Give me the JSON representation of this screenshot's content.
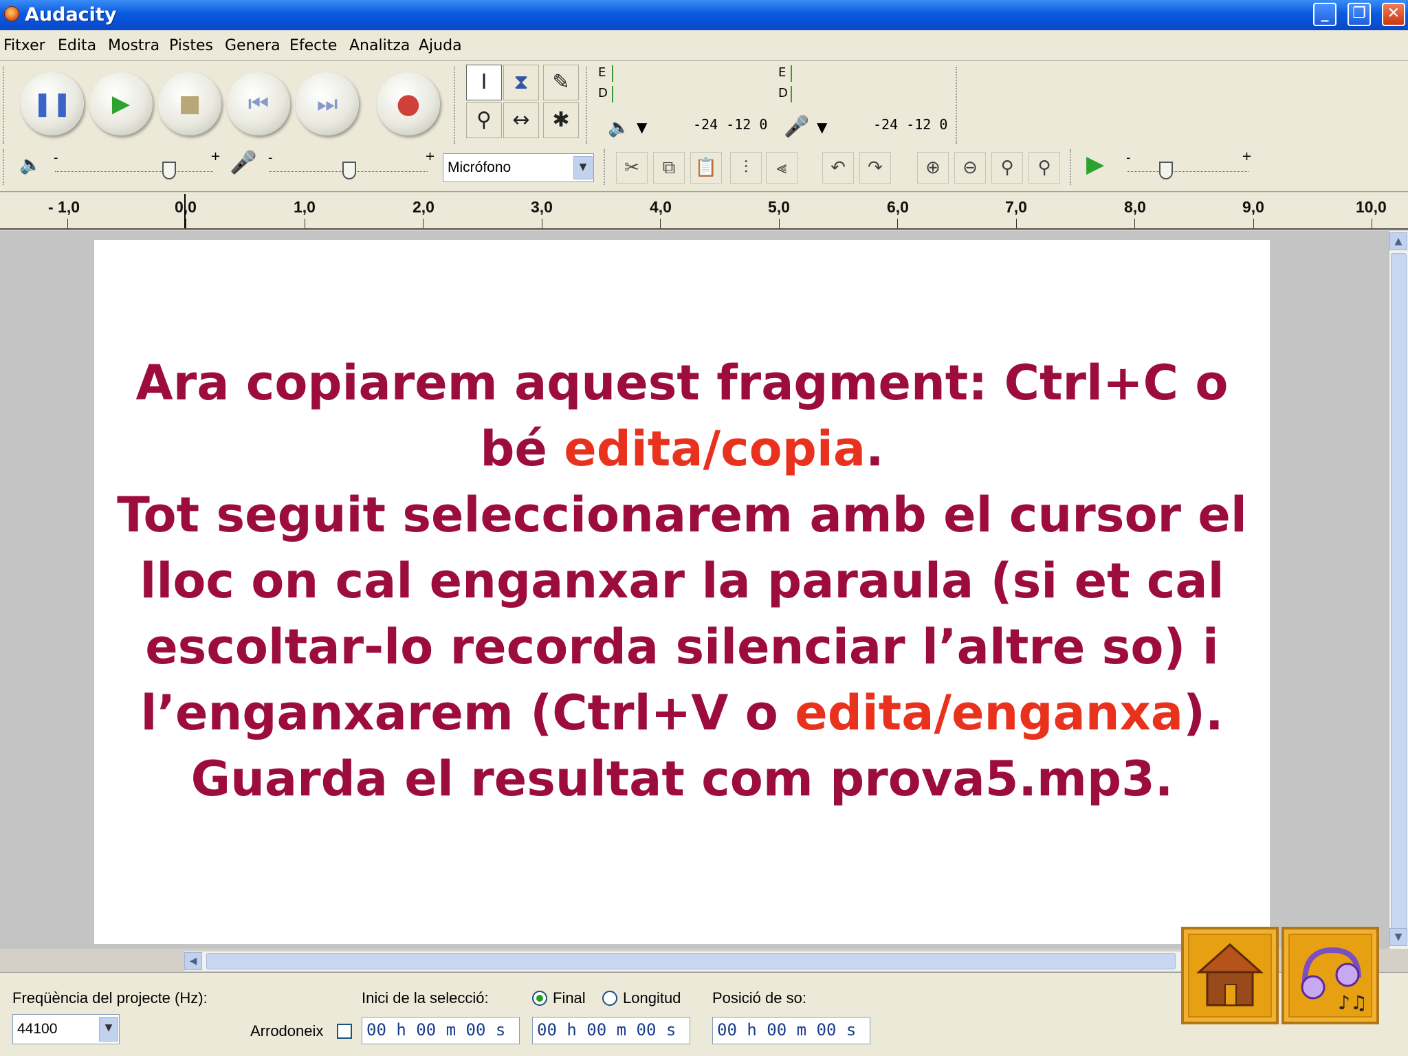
{
  "window": {
    "title": "Audacity"
  },
  "menu": [
    "Fitxer",
    "Edita",
    "Mostra",
    "Pistes",
    "Genera",
    "Efecte",
    "Analitza",
    "Ajuda"
  ],
  "meters": {
    "play_channels": [
      "E",
      "D"
    ],
    "rec_channels": [
      "E",
      "D"
    ],
    "play_scale": "-24  -12   0",
    "rec_scale": "-24  -12   0"
  },
  "mixer": {
    "input_source": "Micrófono",
    "slider_minus": "-",
    "slider_plus": "+"
  },
  "ruler": {
    "ticks": [
      "- 1,0",
      "0,0",
      "1,0",
      "2,0",
      "3,0",
      "4,0",
      "5,0",
      "6,0",
      "7,0",
      "8,0",
      "9,0",
      "10,0"
    ]
  },
  "slide": {
    "line1": "Ara copiarem aquest fragment: Ctrl+C o",
    "line2_a": "bé ",
    "line2_hl": "edita/copia",
    "line2_b": ".",
    "line3": "Tot seguit seleccionarem amb el cursor el",
    "line4": "lloc on cal enganxar la paraula (si et cal",
    "line5": "escoltar-lo recorda silenciar l’altre so) i",
    "line6_a": "l’enganxarem (Ctrl+V o ",
    "line6_hl": "edita/enganxa",
    "line6_b": ").",
    "line7": "Guarda el resultat com prova5.mp3."
  },
  "status": {
    "rate_label": "Freqüència del projecte (Hz):",
    "rate_value": "44100",
    "snap_label": "Arrodoneix",
    "sel_start_label": "Inici de la selecció:",
    "radio_end": "Final",
    "radio_length": "Longitud",
    "position_label": "Posició de so:",
    "sel_start_time": "00 h 00 m 00 s",
    "sel_end_time": "00 h 00 m 00 s",
    "position_time": "00 h 00 m 00 s"
  },
  "colors": {
    "slide_text": "#9c0c3c",
    "highlight": "#e8321e",
    "nav_button": "#e7a012"
  }
}
